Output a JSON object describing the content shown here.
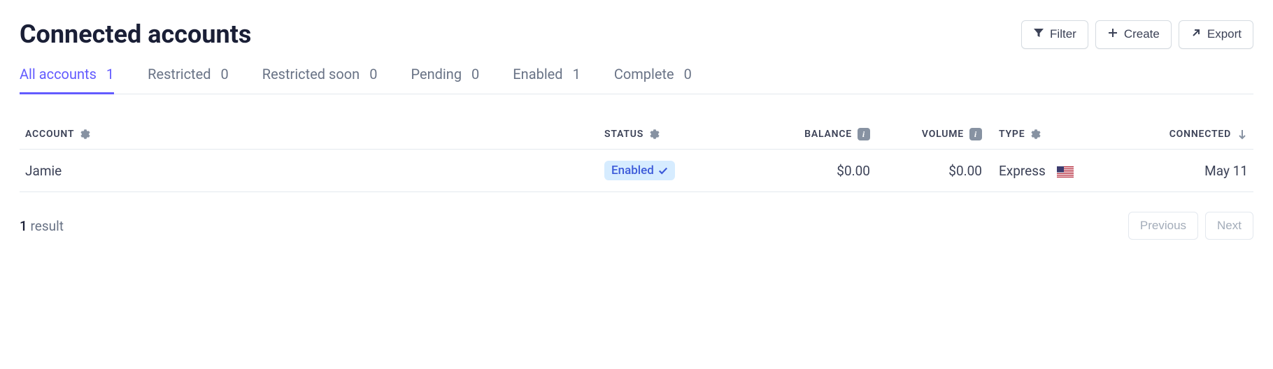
{
  "header": {
    "title": "Connected accounts",
    "actions": {
      "filter": "Filter",
      "create": "Create",
      "export": "Export"
    }
  },
  "tabs": [
    {
      "label": "All accounts",
      "count": "1",
      "active": true
    },
    {
      "label": "Restricted",
      "count": "0",
      "active": false
    },
    {
      "label": "Restricted soon",
      "count": "0",
      "active": false
    },
    {
      "label": "Pending",
      "count": "0",
      "active": false
    },
    {
      "label": "Enabled",
      "count": "1",
      "active": false
    },
    {
      "label": "Complete",
      "count": "0",
      "active": false
    }
  ],
  "columns": {
    "account": "ACCOUNT",
    "status": "STATUS",
    "balance": "BALANCE",
    "volume": "VOLUME",
    "type": "TYPE",
    "connected": "CONNECTED"
  },
  "rows": [
    {
      "account": "Jamie",
      "status": "Enabled",
      "balance": "$0.00",
      "volume": "$0.00",
      "type": "Express",
      "country": "US",
      "connected": "May 11"
    }
  ],
  "footer": {
    "result_number": "1",
    "result_label": " result",
    "previous": "Previous",
    "next": "Next"
  }
}
